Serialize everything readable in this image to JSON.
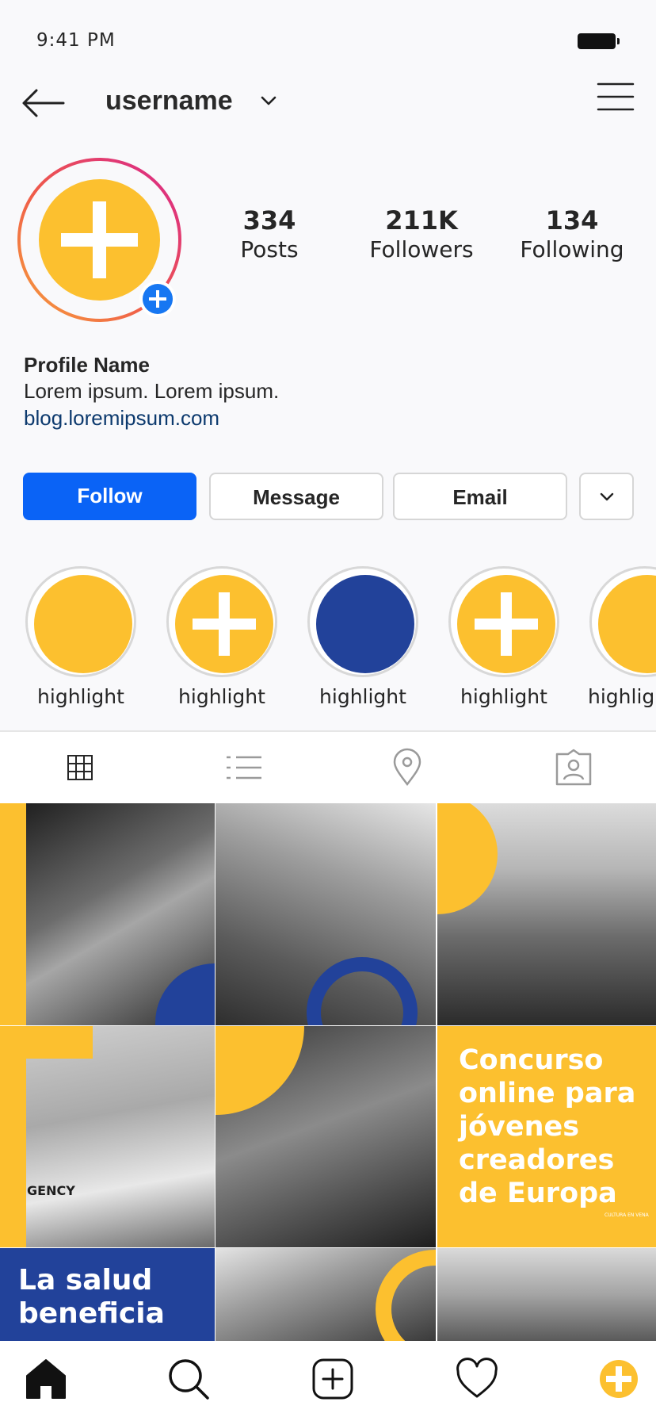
{
  "status_bar": {
    "time": "9:41 PM"
  },
  "header": {
    "username": "username"
  },
  "profile": {
    "stats": [
      {
        "value": "334",
        "label": "Posts"
      },
      {
        "value": "211K",
        "label": "Followers"
      },
      {
        "value": "134",
        "label": "Following"
      }
    ],
    "name": "Profile Name",
    "bio": "Lorem ipsum. Lorem ipsum.",
    "link": "blog.loremipsum.com"
  },
  "actions": {
    "follow": "Follow",
    "message": "Message",
    "email": "Email"
  },
  "highlights": [
    {
      "label": "highlight",
      "color": "#fcc02f",
      "icon": "none"
    },
    {
      "label": "highlight",
      "color": "#fcc02f",
      "icon": "plus-icon"
    },
    {
      "label": "highlight",
      "color": "#22429a",
      "icon": "none"
    },
    {
      "label": "highlight",
      "color": "#fcc02f",
      "icon": "plus-icon"
    },
    {
      "label": "highlight",
      "color": "#fcc02f",
      "icon": "none"
    }
  ],
  "tabs": [
    "grid-icon",
    "list-icon",
    "location-pin-icon",
    "tagged-icon"
  ],
  "posts": {
    "tile_5_text": "Concurso online para jóvenes creadores de Europa",
    "tile_5_brand": "CULTURA EN VENA",
    "tile_3_sign": "GENCY",
    "tile_6_text": "La salud beneficia"
  },
  "colors": {
    "brand_yellow": "#fcc02f",
    "brand_blue": "#22429a",
    "accent_blue": "#0a63f6"
  },
  "bottom_nav": [
    "home-icon",
    "search-icon",
    "new-post-icon",
    "heart-icon",
    "profile-icon"
  ]
}
